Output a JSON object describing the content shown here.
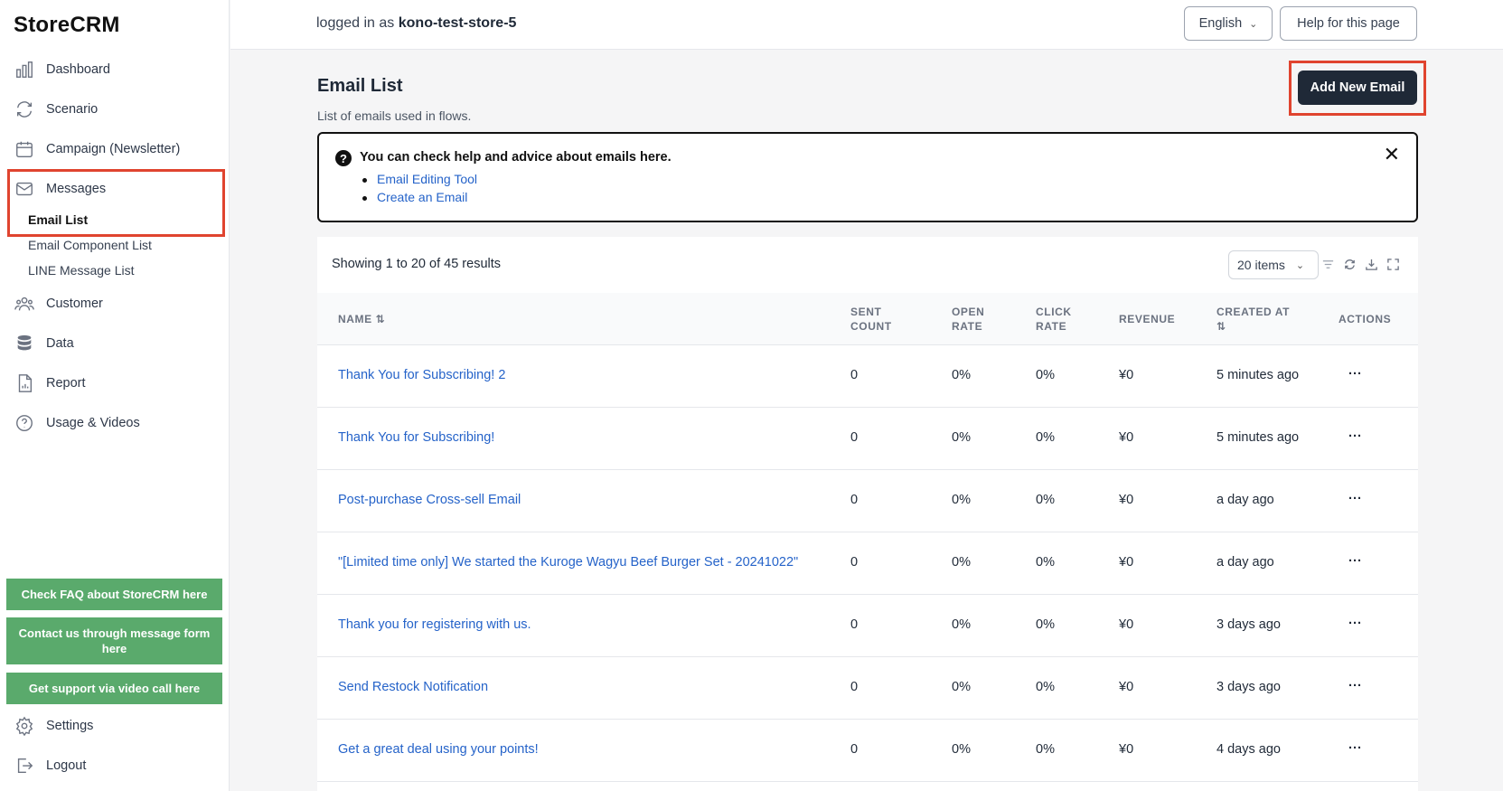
{
  "app": {
    "logo": "StoreCRM"
  },
  "sidebar": {
    "items": [
      {
        "label": "Dashboard",
        "icon": "bar-chart-icon"
      },
      {
        "label": "Scenario",
        "icon": "refresh-icon"
      },
      {
        "label": "Campaign (Newsletter)",
        "icon": "calendar-icon"
      },
      {
        "label": "Messages",
        "icon": "mail-icon"
      },
      {
        "label": "Customer",
        "icon": "users-icon"
      },
      {
        "label": "Data",
        "icon": "database-icon"
      },
      {
        "label": "Report",
        "icon": "document-chart-icon"
      },
      {
        "label": "Usage & Videos",
        "icon": "help-circle-icon"
      }
    ],
    "messages_sub": [
      "Email List",
      "Email Component List",
      "LINE Message List"
    ],
    "support_buttons": [
      "Check FAQ about StoreCRM here",
      "Contact us through message form here",
      "Get support via video call here"
    ],
    "settings": "Settings",
    "logout": "Logout"
  },
  "header": {
    "logged_in_prefix": "logged in as",
    "store": "kono-test-store-5",
    "language": "English",
    "help_button": "Help for this page"
  },
  "main": {
    "title": "Email List",
    "subtitle": "List of emails used in flows.",
    "add_button": "Add New Email",
    "help": {
      "title": "You can check help and advice about emails here.",
      "links": [
        "Email Editing Tool",
        "Create an Email"
      ]
    },
    "table": {
      "showing": "Showing 1 to 20 of 45 results",
      "page_size": "20 items",
      "columns": {
        "name": "NAME ⇅",
        "sent_1": "SENT",
        "sent_2": "COUNT",
        "open_1": "OPEN",
        "open_2": "RATE",
        "click_1": "CLICK",
        "click_2": "RATE",
        "revenue": "REVENUE",
        "created_1": "CREATED AT",
        "created_2": "⇅",
        "actions": "ACTIONS"
      },
      "rows": [
        {
          "name": "Thank You for Subscribing! 2",
          "sent": "0",
          "open": "0%",
          "click": "0%",
          "revenue": "¥0",
          "created": "5 minutes ago",
          "actions": "..."
        },
        {
          "name": "Thank You for Subscribing!",
          "sent": "0",
          "open": "0%",
          "click": "0%",
          "revenue": "¥0",
          "created": "5 minutes ago",
          "actions": "..."
        },
        {
          "name": "Post-purchase Cross-sell Email",
          "sent": "0",
          "open": "0%",
          "click": "0%",
          "revenue": "¥0",
          "created": "a day ago",
          "actions": "..."
        },
        {
          "name": "\"[Limited time only] We started the Kuroge Wagyu Beef Burger Set - 20241022\"",
          "sent": "0",
          "open": "0%",
          "click": "0%",
          "revenue": "¥0",
          "created": "a day ago",
          "actions": "..."
        },
        {
          "name": "Thank you for registering with us.",
          "sent": "0",
          "open": "0%",
          "click": "0%",
          "revenue": "¥0",
          "created": "3 days ago",
          "actions": "..."
        },
        {
          "name": "Send Restock Notification",
          "sent": "0",
          "open": "0%",
          "click": "0%",
          "revenue": "¥0",
          "created": "3 days ago",
          "actions": "..."
        },
        {
          "name": "Get a great deal using your points!",
          "sent": "0",
          "open": "0%",
          "click": "0%",
          "revenue": "¥0",
          "created": "4 days ago",
          "actions": "..."
        }
      ]
    }
  },
  "colors": {
    "accent_link": "#2563c9",
    "primary_button": "#1f2937",
    "support_green": "#5aaa6c",
    "highlight_red": "#e0442f"
  }
}
